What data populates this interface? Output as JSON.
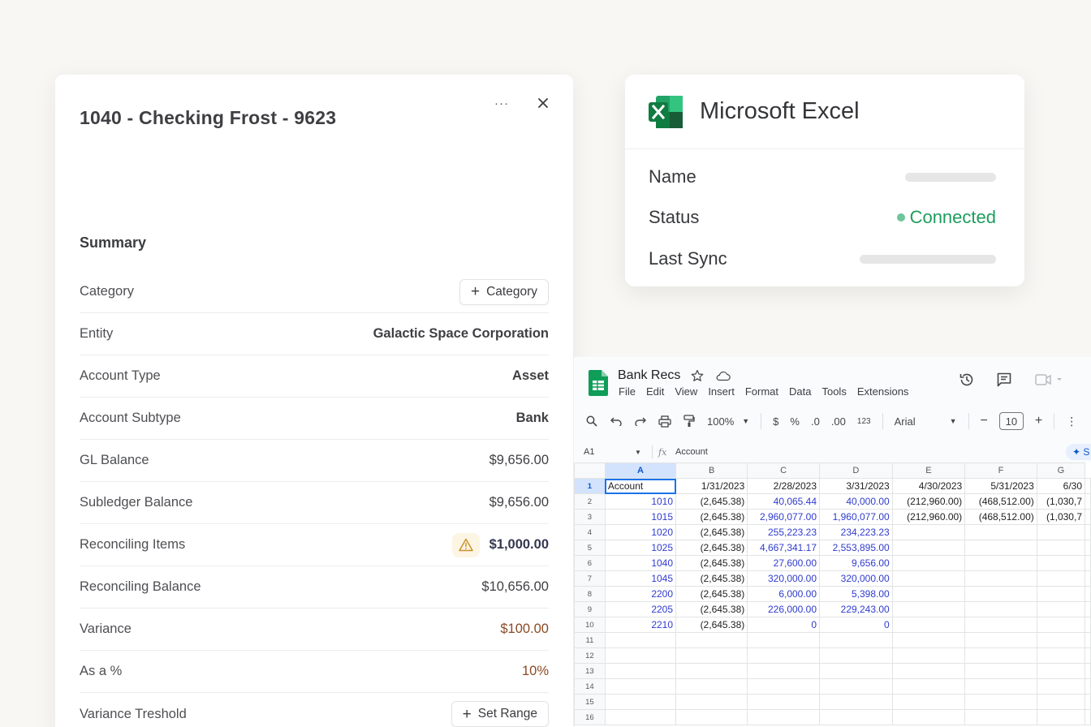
{
  "panel": {
    "title": "1040 - Checking Frost - 9623",
    "more_label": "···",
    "summary_title": "Summary",
    "rows": [
      {
        "label": "Category",
        "button": "Category"
      },
      {
        "label": "Entity",
        "value": "Galactic Space Corporation"
      },
      {
        "label": "Account Type",
        "value": "Asset"
      },
      {
        "label": "Account Subtype",
        "value": "Bank"
      },
      {
        "label": "GL Balance",
        "value": "$9,656.00"
      },
      {
        "label": "Subledger Balance",
        "value": "$9,656.00"
      },
      {
        "label": "Reconciling Items",
        "value": "$1,000.00"
      },
      {
        "label": "Reconciling Balance",
        "value": "$10,656.00"
      },
      {
        "label": "Variance",
        "value": "$100.00"
      },
      {
        "label": "As a %",
        "value": "10%"
      },
      {
        "label": "Variance Treshold",
        "button": "Set Range"
      }
    ]
  },
  "excel": {
    "app_name": "Microsoft Excel",
    "name_label": "Name",
    "status_label": "Status",
    "status_value": "Connected",
    "last_sync_label": "Last Sync",
    "colors": {
      "status": "#1e9d5e",
      "status_dot": "#6ec59a",
      "excel_green": "#107c41"
    }
  },
  "sheet": {
    "title": "Bank Recs",
    "menu": [
      "File",
      "Edit",
      "View",
      "Insert",
      "Format",
      "Data",
      "Tools",
      "Extensions"
    ],
    "zoom": "100%",
    "toolbar": {
      "currency": "$",
      "percent": "%",
      "dec_less": ".0",
      "dec_more": ".00",
      "number_format": "123",
      "font": "Arial",
      "font_size": "10",
      "minus": "−",
      "plus": "+"
    },
    "cell_ref": "A1",
    "formula_content": "Account",
    "columns": [
      "A",
      "B",
      "C",
      "D",
      "E",
      "F",
      "G"
    ],
    "rows": [
      [
        "Account",
        "1/31/2023",
        "2/28/2023",
        "3/31/2023",
        "4/30/2023",
        "5/31/2023",
        "6/30"
      ],
      [
        "1010",
        "(2,645.38)",
        "40,065.44",
        "40,000.00",
        "(212,960.00)",
        "(468,512.00)",
        "(1,030,7"
      ],
      [
        "1015",
        "(2,645.38)",
        "2,960,077.00",
        "1,960,077.00",
        "(212,960.00)",
        "(468,512.00)",
        "(1,030,7"
      ],
      [
        "1020",
        "(2,645.38)",
        "255,223.23",
        "234,223.23",
        "",
        "",
        ""
      ],
      [
        "1025",
        "(2,645.38)",
        "4,667,341.17",
        "2,553,895.00",
        "",
        "",
        ""
      ],
      [
        "1040",
        "(2,645.38)",
        "27,600.00",
        "9,656.00",
        "",
        "",
        ""
      ],
      [
        "1045",
        "(2,645.38)",
        "320,000.00",
        "320,000.00",
        "",
        "",
        ""
      ],
      [
        "2200",
        "(2,645.38)",
        "6,000.00",
        "5,398.00",
        "",
        "",
        ""
      ],
      [
        "2205",
        "(2,645.38)",
        "226,000.00",
        "229,243.00",
        "",
        "",
        ""
      ],
      [
        "2210",
        "(2,645.38)",
        "0",
        "0",
        "",
        "",
        ""
      ],
      [
        "",
        "",
        "",
        "",
        "",
        "",
        ""
      ],
      [
        "",
        "",
        "",
        "",
        "",
        "",
        ""
      ],
      [
        "",
        "",
        "",
        "",
        "",
        "",
        ""
      ],
      [
        "",
        "",
        "",
        "",
        "",
        "",
        ""
      ],
      [
        "",
        "",
        "",
        "",
        "",
        "",
        ""
      ],
      [
        "",
        "",
        "",
        "",
        "",
        "",
        ""
      ]
    ]
  }
}
